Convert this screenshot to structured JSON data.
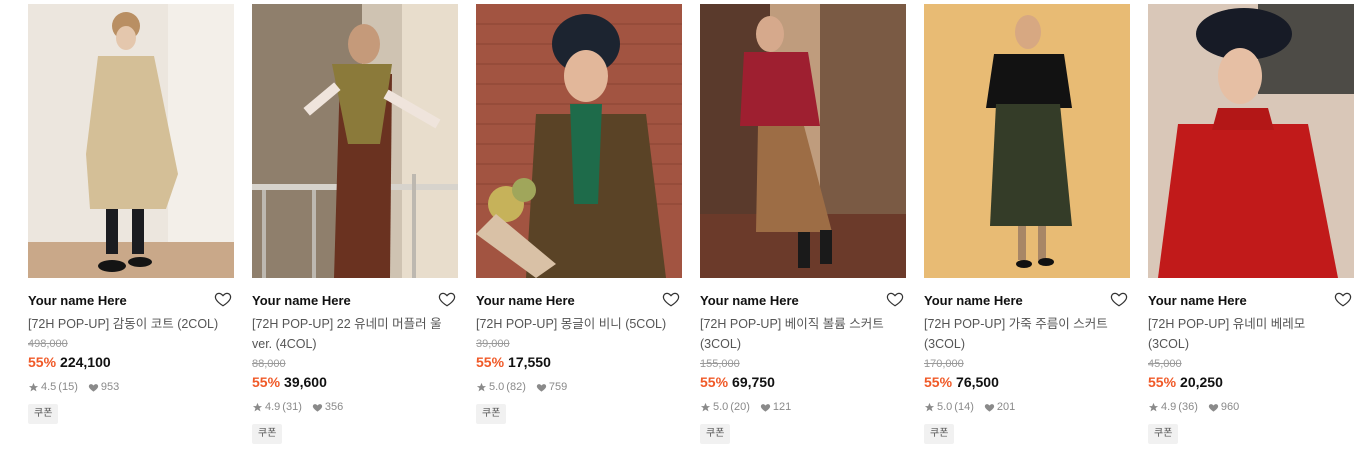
{
  "products": [
    {
      "brand": "Your name Here",
      "name": "[72H POP-UP] 감동이 코트 (2COL)",
      "original_price": "498,000",
      "discount": "55%",
      "price": "224,100",
      "rating": "4.5",
      "reviews": "(15)",
      "likes": "953",
      "coupon": "쿠폰",
      "image": {
        "bg": "#e9e3da",
        "accent": "#d2bd92",
        "desc_color": "#1f2a2c"
      }
    },
    {
      "brand": "Your name Here",
      "name": "[72H POP-UP] 22 유네미 머플러 울ver. (4COL)",
      "original_price": "88,000",
      "discount": "55%",
      "price": "39,600",
      "rating": "4.9",
      "reviews": "(31)",
      "likes": "356",
      "coupon": "쿠폰",
      "image": {
        "bg": "#cdbfae",
        "accent": "#6a3422",
        "desc_color": "#3b3330"
      }
    },
    {
      "brand": "Your name Here",
      "name": "[72H POP-UP] 몽글이 비니 (5COL)",
      "original_price": "39,000",
      "discount": "55%",
      "price": "17,550",
      "rating": "5.0",
      "reviews": "(82)",
      "likes": "759",
      "coupon": "쿠폰",
      "image": {
        "bg": "#9b4a38",
        "accent": "#5a4326",
        "desc_color": "#1e5a43"
      }
    },
    {
      "brand": "Your name Here",
      "name": "[72H POP-UP] 베이직 볼륨 스커트 (3COL)",
      "original_price": "155,000",
      "discount": "55%",
      "price": "69,750",
      "rating": "5.0",
      "reviews": "(20)",
      "likes": "121",
      "coupon": "쿠폰",
      "image": {
        "bg": "#b89473",
        "accent": "#9c1f2d",
        "desc_color": "#8b5a3c"
      }
    },
    {
      "brand": "Your name Here",
      "name": "[72H POP-UP] 가죽 주름이 스커트 (3COL)",
      "original_price": "170,000",
      "discount": "55%",
      "price": "76,500",
      "rating": "5.0",
      "reviews": "(14)",
      "likes": "201",
      "coupon": "쿠폰",
      "image": {
        "bg": "#e3b873",
        "accent": "#151515",
        "desc_color": "#38402c"
      }
    },
    {
      "brand": "Your name Here",
      "name": "[72H POP-UP] 유네미 베레모 (3COL)",
      "original_price": "45,000",
      "discount": "55%",
      "price": "20,250",
      "rating": "4.9",
      "reviews": "(36)",
      "likes": "960",
      "coupon": "쿠폰",
      "image": {
        "bg": "#d7c3b4",
        "accent": "#c21c1c",
        "desc_color": "#161a22"
      }
    }
  ],
  "icons": {
    "wishlist": "heart-outline-icon",
    "rating": "star-icon",
    "likes": "heart-filled-icon"
  },
  "colors": {
    "discount": "#f05a28",
    "muted": "#8a8a8a"
  }
}
